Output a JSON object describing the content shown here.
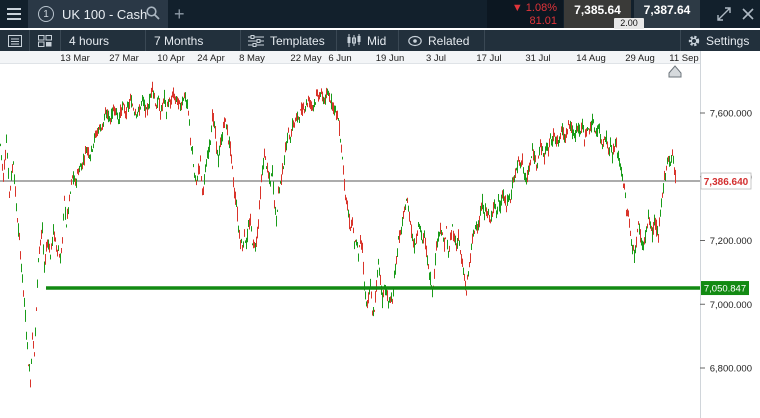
{
  "topbar": {
    "tab_number": "1",
    "instrument_name": "UK 100 - Cash",
    "change_pct": "▼ 1.08%",
    "change_abs": "81.01",
    "sell_price": "7,385.64",
    "buy_price": "7,387.64",
    "spread": "2.00"
  },
  "toolbar": {
    "interval": "4 hours",
    "range": "7 Months",
    "templates_label": "Templates",
    "price_type_label": "Mid",
    "related_label": "Related",
    "settings_label": "Settings"
  },
  "chart_data": {
    "type": "candlestick",
    "date_labels": [
      "13 Mar",
      "27 Mar",
      "10 Apr",
      "24 Apr",
      "8 May",
      "22 May",
      "6 Jun",
      "19 Jun",
      "3 Jul",
      "17 Jul",
      "31 Jul",
      "14 Aug",
      "29 Aug",
      "11 Sep"
    ],
    "y_ticks": [
      "7,600.000",
      "7,400.000",
      "7,200.000",
      "7,000.000",
      "6,800.000"
    ],
    "y_tick_values": [
      7600,
      7400,
      7200,
      7000,
      6800
    ],
    "ylim": [
      6720,
      7760
    ],
    "current_price_label": "7,386.640",
    "current_price": 7386.64,
    "support_level_label": "7,050.847",
    "support_level": 7050.847,
    "up_color": "#1a9c1a",
    "down_color": "#d9342b",
    "support_color": "#128a12",
    "path_points": [
      [
        0,
        7500
      ],
      [
        3,
        7400
      ],
      [
        6,
        7520
      ],
      [
        9,
        7350
      ],
      [
        13,
        7450
      ],
      [
        16,
        7300
      ],
      [
        19,
        7200
      ],
      [
        22,
        7080
      ],
      [
        25,
        6960
      ],
      [
        28,
        6820
      ],
      [
        30,
        6760
      ],
      [
        32,
        6900
      ],
      [
        34,
        6850
      ],
      [
        36,
        6980
      ],
      [
        38,
        7150
      ],
      [
        40,
        7200
      ],
      [
        42,
        7230
      ],
      [
        44,
        7110
      ],
      [
        46,
        7180
      ],
      [
        48,
        7200
      ],
      [
        50,
        7150
      ],
      [
        53,
        7230
      ],
      [
        56,
        7180
      ],
      [
        58,
        7170
      ],
      [
        60,
        7140
      ],
      [
        62,
        7200
      ],
      [
        64,
        7330
      ],
      [
        66,
        7250
      ],
      [
        68,
        7300
      ],
      [
        70,
        7350
      ],
      [
        72,
        7400
      ],
      [
        75,
        7380
      ],
      [
        78,
        7420
      ],
      [
        82,
        7440
      ],
      [
        86,
        7490
      ],
      [
        90,
        7470
      ],
      [
        94,
        7520
      ],
      [
        98,
        7550
      ],
      [
        102,
        7560
      ],
      [
        106,
        7600
      ],
      [
        110,
        7580
      ],
      [
        114,
        7620
      ],
      [
        118,
        7580
      ],
      [
        122,
        7620
      ],
      [
        126,
        7600
      ],
      [
        130,
        7640
      ],
      [
        134,
        7610
      ],
      [
        138,
        7600
      ],
      [
        142,
        7640
      ],
      [
        146,
        7600
      ],
      [
        150,
        7650
      ],
      [
        152,
        7690
      ],
      [
        154,
        7650
      ],
      [
        156,
        7620
      ],
      [
        158,
        7640
      ],
      [
        160,
        7600
      ],
      [
        162,
        7620
      ],
      [
        164,
        7650
      ],
      [
        166,
        7600
      ],
      [
        168,
        7640
      ],
      [
        170,
        7620
      ],
      [
        172,
        7660
      ],
      [
        176,
        7640
      ],
      [
        180,
        7620
      ],
      [
        184,
        7660
      ],
      [
        188,
        7600
      ],
      [
        190,
        7520
      ],
      [
        192,
        7470
      ],
      [
        194,
        7400
      ],
      [
        196,
        7380
      ],
      [
        198,
        7420
      ],
      [
        200,
        7450
      ],
      [
        202,
        7350
      ],
      [
        204,
        7390
      ],
      [
        206,
        7440
      ],
      [
        208,
        7480
      ],
      [
        210,
        7520
      ],
      [
        212,
        7590
      ],
      [
        214,
        7560
      ],
      [
        216,
        7500
      ],
      [
        218,
        7450
      ],
      [
        220,
        7500
      ],
      [
        222,
        7530
      ],
      [
        224,
        7580
      ],
      [
        226,
        7560
      ],
      [
        228,
        7520
      ],
      [
        230,
        7490
      ],
      [
        232,
        7420
      ],
      [
        234,
        7350
      ],
      [
        236,
        7320
      ],
      [
        238,
        7240
      ],
      [
        240,
        7200
      ],
      [
        242,
        7180
      ],
      [
        244,
        7220
      ],
      [
        246,
        7190
      ],
      [
        248,
        7240
      ],
      [
        250,
        7260
      ],
      [
        252,
        7200
      ],
      [
        254,
        7180
      ],
      [
        256,
        7200
      ],
      [
        258,
        7260
      ],
      [
        260,
        7350
      ],
      [
        262,
        7420
      ],
      [
        264,
        7470
      ],
      [
        266,
        7440
      ],
      [
        268,
        7400
      ],
      [
        270,
        7380
      ],
      [
        272,
        7420
      ],
      [
        274,
        7320
      ],
      [
        276,
        7260
      ],
      [
        278,
        7350
      ],
      [
        280,
        7380
      ],
      [
        282,
        7420
      ],
      [
        284,
        7460
      ],
      [
        286,
        7500
      ],
      [
        288,
        7540
      ],
      [
        290,
        7520
      ],
      [
        292,
        7560
      ],
      [
        296,
        7580
      ],
      [
        300,
        7600
      ],
      [
        304,
        7620
      ],
      [
        308,
        7640
      ],
      [
        312,
        7620
      ],
      [
        316,
        7650
      ],
      [
        320,
        7660
      ],
      [
        324,
        7640
      ],
      [
        328,
        7660
      ],
      [
        332,
        7630
      ],
      [
        336,
        7600
      ],
      [
        338,
        7580
      ],
      [
        340,
        7520
      ],
      [
        342,
        7460
      ],
      [
        344,
        7380
      ],
      [
        346,
        7320
      ],
      [
        348,
        7280
      ],
      [
        350,
        7240
      ],
      [
        352,
        7260
      ],
      [
        354,
        7180
      ],
      [
        356,
        7200
      ],
      [
        358,
        7150
      ],
      [
        360,
        7200
      ],
      [
        362,
        7180
      ],
      [
        364,
        7060
      ],
      [
        366,
        7000
      ],
      [
        368,
        7020
      ],
      [
        370,
        7060
      ],
      [
        372,
        6980
      ],
      [
        374,
        6980
      ],
      [
        376,
        7060
      ],
      [
        378,
        7120
      ],
      [
        380,
        7080
      ],
      [
        382,
        7010
      ],
      [
        384,
        7060
      ],
      [
        386,
        7040
      ],
      [
        388,
        7000
      ],
      [
        390,
        7020
      ],
      [
        392,
        7000
      ],
      [
        394,
        7090
      ],
      [
        396,
        7140
      ],
      [
        398,
        7200
      ],
      [
        400,
        7220
      ],
      [
        402,
        7250
      ],
      [
        404,
        7290
      ],
      [
        406,
        7330
      ],
      [
        408,
        7300
      ],
      [
        410,
        7260
      ],
      [
        412,
        7210
      ],
      [
        414,
        7180
      ],
      [
        416,
        7210
      ],
      [
        418,
        7260
      ],
      [
        420,
        7230
      ],
      [
        422,
        7200
      ],
      [
        424,
        7210
      ],
      [
        426,
        7170
      ],
      [
        428,
        7110
      ],
      [
        430,
        7080
      ],
      [
        432,
        7040
      ],
      [
        434,
        7100
      ],
      [
        436,
        7180
      ],
      [
        438,
        7220
      ],
      [
        440,
        7240
      ],
      [
        442,
        7210
      ],
      [
        444,
        7190
      ],
      [
        446,
        7230
      ],
      [
        448,
        7150
      ],
      [
        450,
        7200
      ],
      [
        452,
        7240
      ],
      [
        454,
        7210
      ],
      [
        456,
        7180
      ],
      [
        458,
        7220
      ],
      [
        460,
        7160
      ],
      [
        462,
        7120
      ],
      [
        464,
        7080
      ],
      [
        466,
        7040
      ],
      [
        468,
        7100
      ],
      [
        470,
        7150
      ],
      [
        472,
        7200
      ],
      [
        474,
        7230
      ],
      [
        476,
        7260
      ],
      [
        478,
        7240
      ],
      [
        480,
        7280
      ],
      [
        482,
        7320
      ],
      [
        484,
        7280
      ],
      [
        486,
        7300
      ],
      [
        488,
        7280
      ],
      [
        490,
        7250
      ],
      [
        492,
        7300
      ],
      [
        494,
        7320
      ],
      [
        496,
        7280
      ],
      [
        498,
        7320
      ],
      [
        500,
        7300
      ],
      [
        502,
        7350
      ],
      [
        504,
        7330
      ],
      [
        506,
        7300
      ],
      [
        508,
        7340
      ],
      [
        510,
        7320
      ],
      [
        512,
        7380
      ],
      [
        514,
        7400
      ],
      [
        516,
        7420
      ],
      [
        518,
        7450
      ],
      [
        520,
        7430
      ],
      [
        522,
        7460
      ],
      [
        524,
        7400
      ],
      [
        526,
        7380
      ],
      [
        528,
        7420
      ],
      [
        530,
        7440
      ],
      [
        532,
        7480
      ],
      [
        534,
        7460
      ],
      [
        536,
        7440
      ],
      [
        538,
        7470
      ],
      [
        540,
        7500
      ],
      [
        542,
        7480
      ],
      [
        544,
        7460
      ],
      [
        546,
        7500
      ],
      [
        548,
        7480
      ],
      [
        550,
        7520
      ],
      [
        552,
        7510
      ],
      [
        554,
        7540
      ],
      [
        556,
        7520
      ],
      [
        558,
        7500
      ],
      [
        560,
        7530
      ],
      [
        562,
        7550
      ],
      [
        564,
        7520
      ],
      [
        566,
        7540
      ],
      [
        568,
        7570
      ],
      [
        570,
        7560
      ],
      [
        572,
        7540
      ],
      [
        574,
        7520
      ],
      [
        576,
        7550
      ],
      [
        578,
        7560
      ],
      [
        580,
        7540
      ],
      [
        582,
        7560
      ],
      [
        584,
        7520
      ],
      [
        586,
        7550
      ],
      [
        588,
        7540
      ],
      [
        590,
        7560
      ],
      [
        592,
        7570
      ],
      [
        594,
        7550
      ],
      [
        596,
        7540
      ],
      [
        598,
        7560
      ],
      [
        600,
        7520
      ],
      [
        602,
        7500
      ],
      [
        604,
        7530
      ],
      [
        606,
        7520
      ],
      [
        608,
        7480
      ],
      [
        610,
        7500
      ],
      [
        612,
        7470
      ],
      [
        614,
        7490
      ],
      [
        616,
        7500
      ],
      [
        618,
        7460
      ],
      [
        620,
        7430
      ],
      [
        622,
        7400
      ],
      [
        624,
        7360
      ],
      [
        626,
        7300
      ],
      [
        628,
        7280
      ],
      [
        630,
        7220
      ],
      [
        632,
        7180
      ],
      [
        634,
        7150
      ],
      [
        636,
        7200
      ],
      [
        638,
        7250
      ],
      [
        640,
        7220
      ],
      [
        642,
        7180
      ],
      [
        644,
        7200
      ],
      [
        646,
        7230
      ],
      [
        648,
        7270
      ],
      [
        650,
        7250
      ],
      [
        652,
        7220
      ],
      [
        654,
        7260
      ],
      [
        656,
        7240
      ],
      [
        658,
        7210
      ],
      [
        660,
        7280
      ],
      [
        662,
        7340
      ],
      [
        664,
        7400
      ],
      [
        666,
        7430
      ],
      [
        668,
        7460
      ],
      [
        670,
        7440
      ],
      [
        672,
        7480
      ],
      [
        674,
        7420
      ],
      [
        676,
        7380
      ]
    ]
  }
}
